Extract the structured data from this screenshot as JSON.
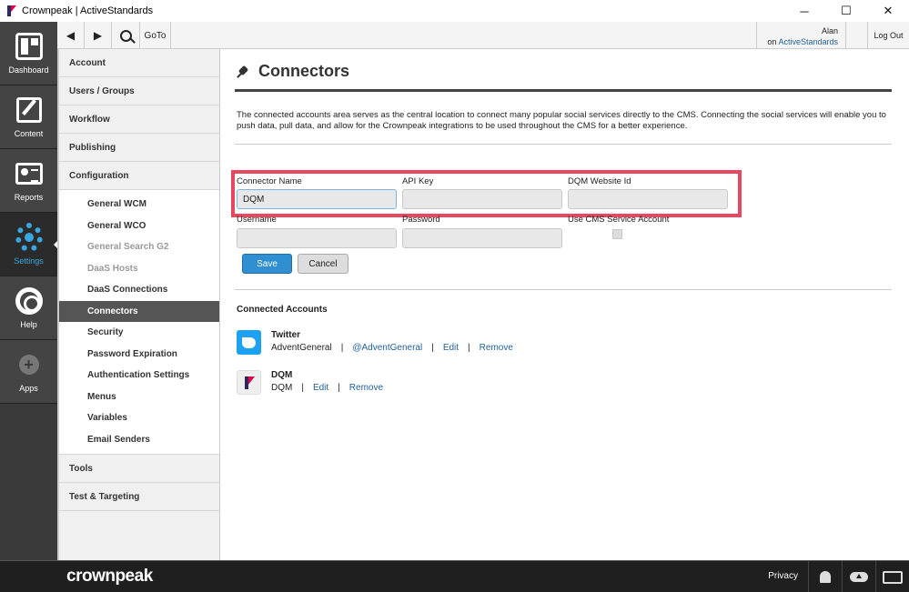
{
  "window": {
    "title": "Crownpeak | ActiveStandards",
    "controls": [
      "─",
      "☐",
      "✕"
    ]
  },
  "rail": {
    "items": [
      {
        "label": "Dashboard",
        "icon": "dashboard-icon"
      },
      {
        "label": "Content",
        "icon": "edit-icon"
      },
      {
        "label": "Reports",
        "icon": "reports-icon"
      },
      {
        "label": "Settings",
        "icon": "gear-icon",
        "active": true
      },
      {
        "label": "Help",
        "icon": "lifebuoy-icon"
      },
      {
        "label": "Apps",
        "icon": "plus-icon"
      }
    ],
    "active_color": "#3aa6e0"
  },
  "toolbar": {
    "back": "◀",
    "forward": "▶",
    "goto": "GoTo",
    "user_name": "Alan",
    "user_on": "on",
    "user_org": "ActiveStandards",
    "logout": "Log Out"
  },
  "settings_nav": {
    "sections": [
      "Account",
      "Users / Groups",
      "Workflow",
      "Publishing",
      "Configuration"
    ],
    "config_items": [
      {
        "label": "General WCM",
        "state": "normal"
      },
      {
        "label": "General WCO",
        "state": "normal"
      },
      {
        "label": "General Search G2",
        "state": "disabled"
      },
      {
        "label": "DaaS Hosts",
        "state": "disabled"
      },
      {
        "label": "DaaS Connections",
        "state": "normal"
      },
      {
        "label": "Connectors",
        "state": "active"
      },
      {
        "label": "Security",
        "state": "normal"
      },
      {
        "label": "Password Expiration",
        "state": "normal"
      },
      {
        "label": "Authentication Settings",
        "state": "normal"
      },
      {
        "label": "Menus",
        "state": "normal"
      },
      {
        "label": "Variables",
        "state": "normal"
      },
      {
        "label": "Email Senders",
        "state": "normal"
      }
    ],
    "bottom_sections": [
      "Tools",
      "Test & Targeting"
    ]
  },
  "page": {
    "title": "Connectors",
    "description": "The connected accounts area serves as the central location to connect many popular social services directly to the CMS. Connecting the social services will enable you to push data, pull data, and allow for the Crownpeak integrations to be used throughout the CMS for a better experience.",
    "form": {
      "connector_name_label": "Connector Name",
      "connector_name_value": "DQM",
      "api_key_label": "API Key",
      "api_key_value": "",
      "dqm_site_label": "DQM Website Id",
      "dqm_site_value": "",
      "username_label": "Username",
      "username_value": "",
      "password_label": "Password",
      "password_value": "",
      "service_account_label": "Use CMS Service Account",
      "service_account_checked": false,
      "save": "Save",
      "cancel": "Cancel",
      "highlight_color": "#e8475f"
    },
    "connected_heading": "Connected Accounts",
    "accounts": [
      {
        "name": "Twitter",
        "account": "AdventGeneral",
        "handle": "@AdventGeneral",
        "edit": "Edit",
        "remove": "Remove",
        "icon": "twitter-icon"
      },
      {
        "name": "DQM",
        "account": "DQM",
        "edit": "Edit",
        "remove": "Remove",
        "icon": "dqm-icon"
      }
    ]
  },
  "footer": {
    "brand": "crownpeak",
    "privacy": "Privacy"
  }
}
